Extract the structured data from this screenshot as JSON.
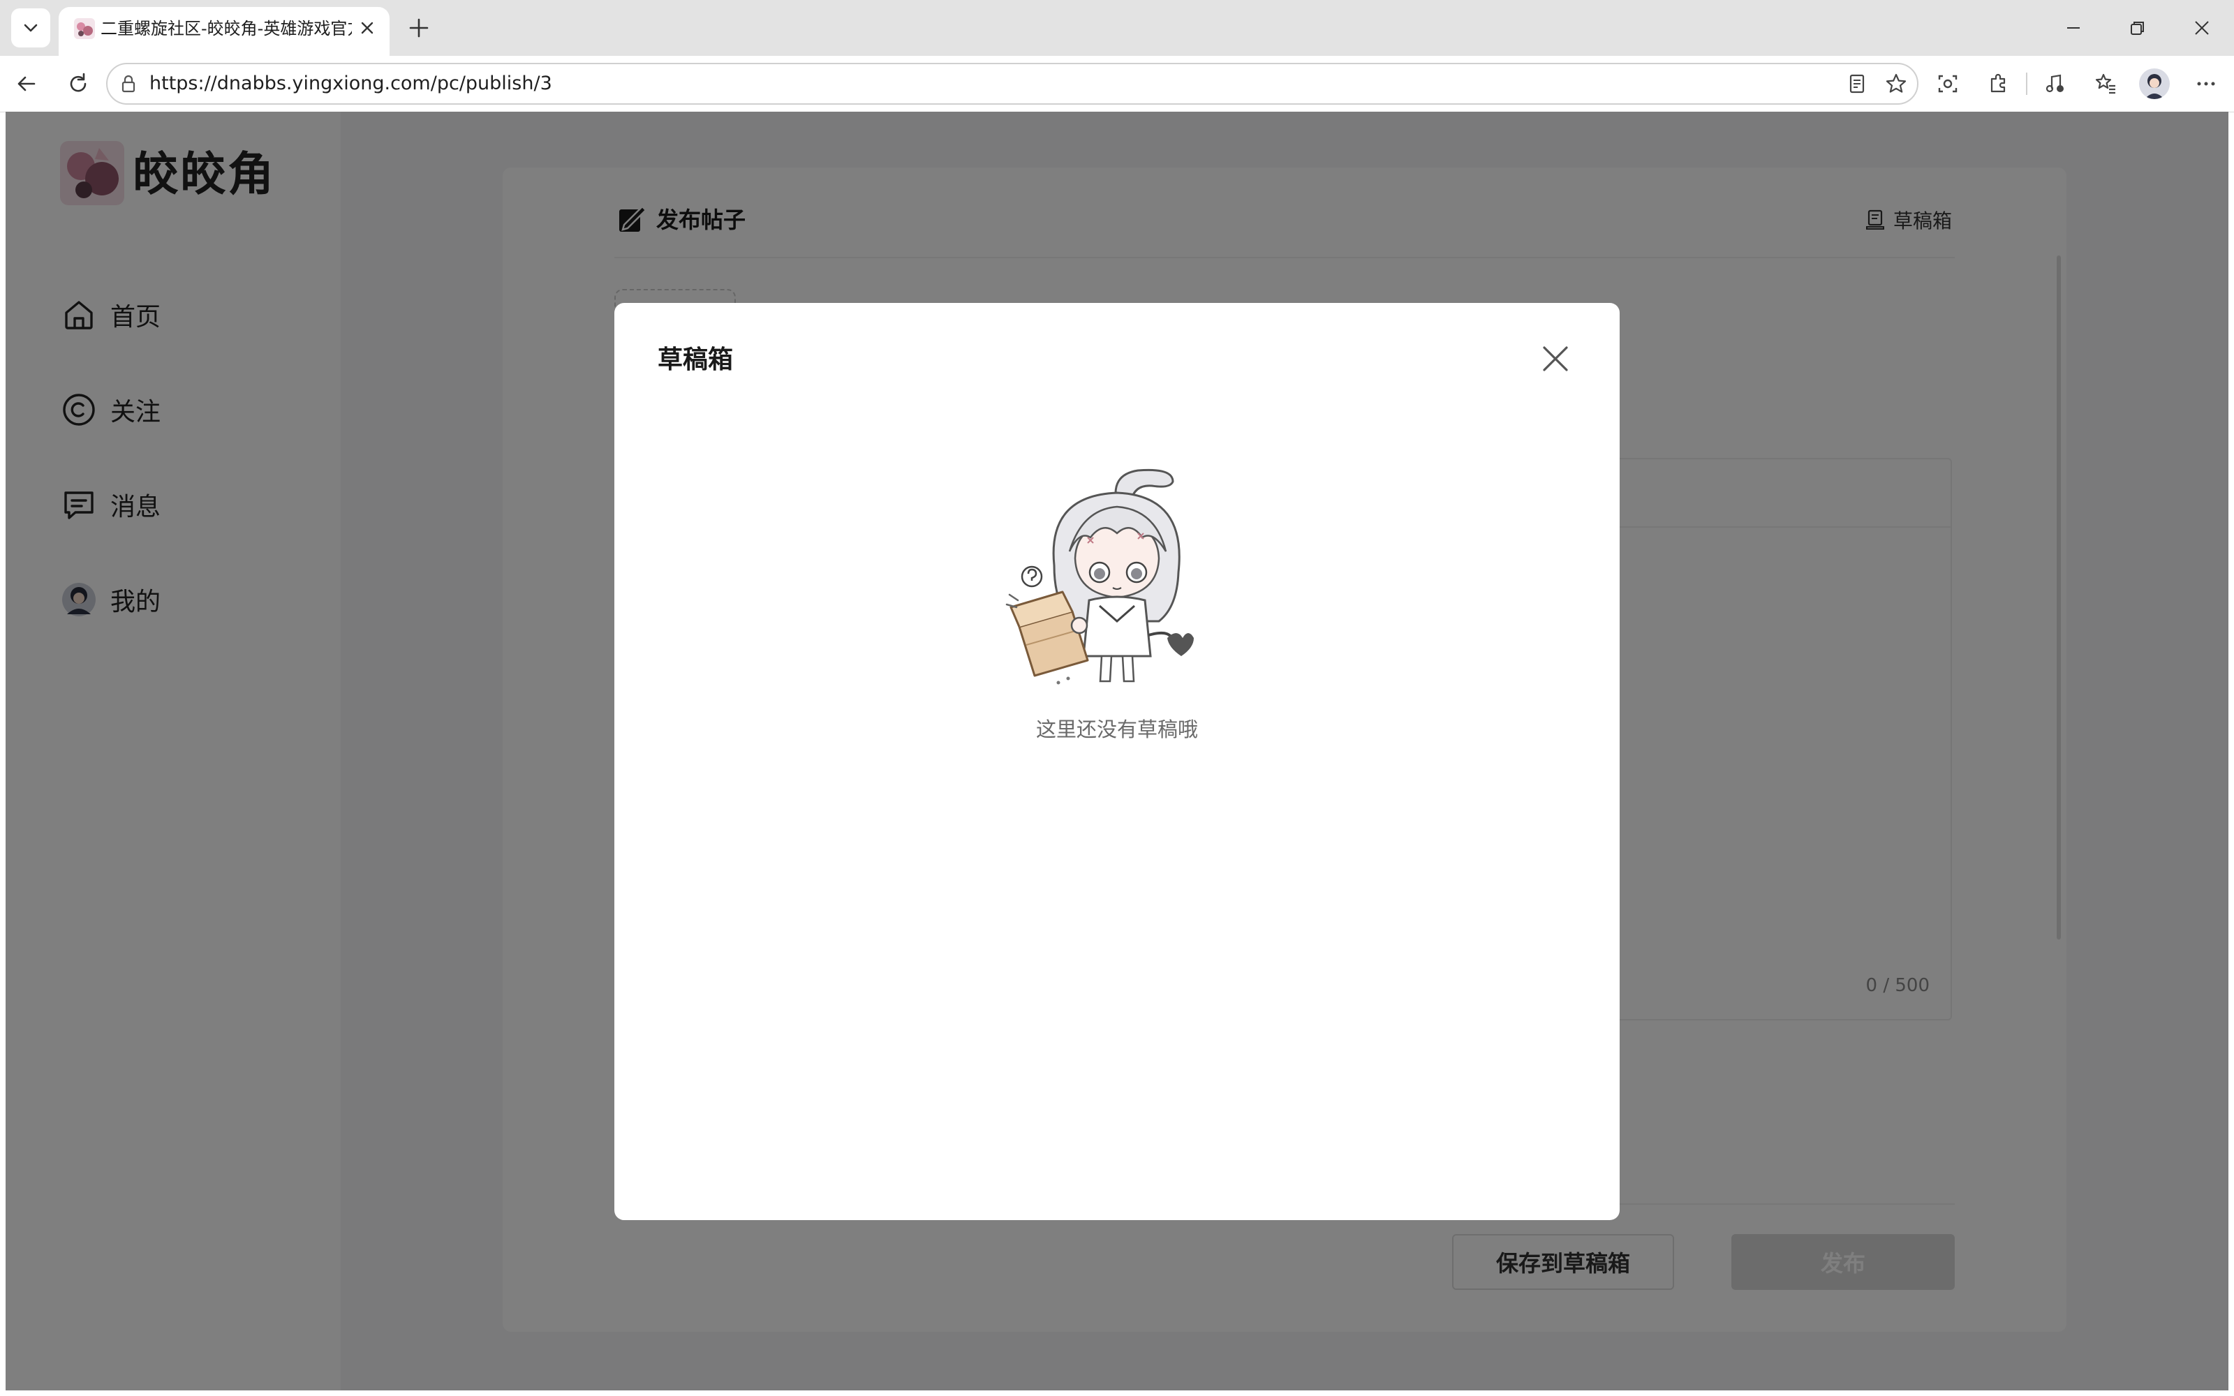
{
  "browser": {
    "tab_title": "二重螺旋社区-皎皎角-英雄游戏官方",
    "url": "https://dnabbs.yingxiong.com/pc/publish/3",
    "icons": [
      "tab-list-icon",
      "close-icon",
      "plus-icon",
      "minimize-icon",
      "restore-icon",
      "window-close-icon",
      "back-icon",
      "reload-icon",
      "lock-icon",
      "reader-mode-icon",
      "favorite-star-icon",
      "screenshot-icon",
      "extensions-icon",
      "media-control-icon",
      "favorites-icon",
      "profile-avatar",
      "more-icon"
    ]
  },
  "site": {
    "logo_text": "皎皎角"
  },
  "sidebar": {
    "items": [
      {
        "label": "首页",
        "icon": "home-icon"
      },
      {
        "label": "关注",
        "icon": "follow-icon"
      },
      {
        "label": "消息",
        "icon": "message-icon"
      },
      {
        "label": "我的",
        "icon": "avatar"
      }
    ]
  },
  "editor": {
    "title": "发布帖子",
    "draft_link": "草稿箱",
    "char_count": "0 / 500",
    "save_draft_label": "保存到草稿箱",
    "publish_label": "发布"
  },
  "modal": {
    "title": "草稿箱",
    "empty_text": "这里还没有草稿哦"
  },
  "colors": {
    "overlay": "rgba(0,0,0,0.5)",
    "page_background": "#f4f5f7",
    "publish_button_disabled": "#d9d9d9"
  }
}
